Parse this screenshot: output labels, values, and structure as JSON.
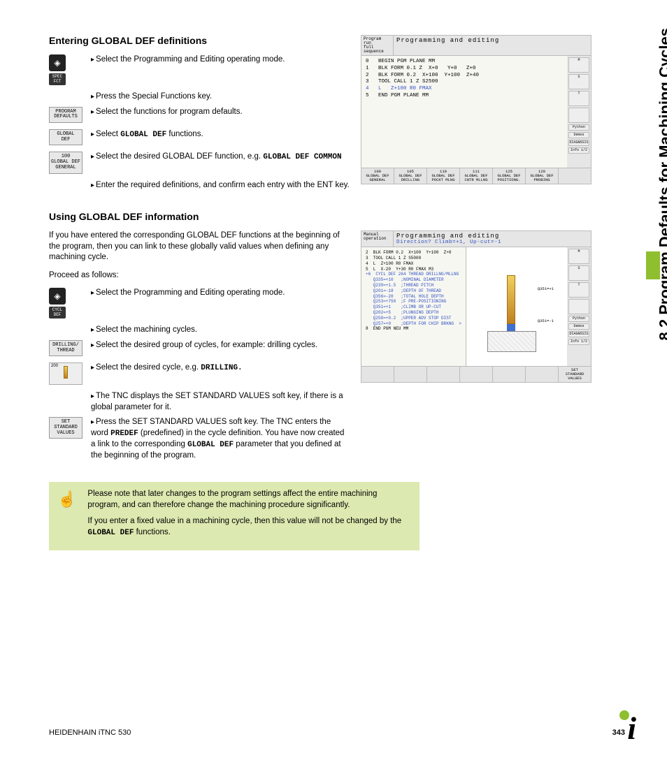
{
  "sideTab": "8.2 Program Defaults for Machining Cycles",
  "section1": {
    "heading": "Entering GLOBAL DEF definitions",
    "steps": [
      "Select the Programming and Editing operating mode.",
      "Press the Special Functions key.",
      "Select the functions for program defaults.",
      "Select ",
      "Select the desired GLOBAL DEF function, e.g. ",
      "Enter the required definitions, and confirm each entry with the ENT key."
    ],
    "step4mono": "GLOBAL DEF",
    "step4after": " functions.",
    "step5mono": "GLOBAL DEF COMMON",
    "softkeys": {
      "specfct": "SPEC\nFCT",
      "progdef": "PROGRAM\nDEFAULTS",
      "globaldef": "GLOBAL\nDEF",
      "gdgen": "100\nGLOBAL DEF\nGENERAL"
    }
  },
  "section2": {
    "heading": "Using GLOBAL DEF information",
    "intro": "If you have entered the corresponding GLOBAL DEF functions at the beginning of the program, then you can link to these globally valid values when defining any machining cycle.",
    "proceed": "Proceed as follows:",
    "steps": {
      "s1": "Select the Programming and Editing operating mode.",
      "s2": "Select the machining cycles.",
      "s3": "Select the desired group of cycles, for example: drilling cycles.",
      "s4pre": "Select the desired cycle, e.g. ",
      "s4mono": "DRILLING.",
      "s5": "The TNC displays the SET STANDARD VALUES soft key, if there is a global parameter for it.",
      "s6pre": "Press the SET STANDARD VALUES soft key. The TNC enters the word ",
      "s6mono1": "PREDEF",
      "s6mid": " (predefined) in the cycle definition. You have now created a link to the corresponding ",
      "s6mono2": "GLOBAL DEF",
      "s6post": " parameter that you defined at the beginning of the program."
    },
    "softkeys": {
      "cycldef": "CYCL\nDEF",
      "drilling": "DRILLING/\nTHREAD",
      "k200": "200",
      "setstd": "SET\nSTANDARD\nVALUES"
    }
  },
  "note": {
    "p1": "Please note that later changes to the program settings affect the entire machining program, and can therefore change the machining procedure significantly.",
    "p2pre": "If you enter a fixed value in a machining cycle, then this value will not be changed by the ",
    "p2mono": "GLOBAL DEF",
    "p2post": " functions."
  },
  "screenshot1": {
    "modeLeft": "Program run\nfull sequence",
    "title": "Programming and editing",
    "lines": [
      "0   BEGIN PGM PLANE MM",
      "1   BLK FORM 0.1 Z  X+0   Y+0   Z+0",
      "2   BLK FORM 0.2  X+100  Y+100  Z+40",
      "3   TOOL CALL 1 Z S2500",
      "4   L   Z+100 R0 FMAX",
      "5   END PGM PLANE MM"
    ],
    "hlLine": 4,
    "rside": [
      "M",
      "S",
      "T",
      "",
      "Python",
      "Demos",
      "DIAGNOSIS",
      "Info 1/2"
    ],
    "fkeys": [
      "100\nGLOBAL DEF\nGENERAL",
      "105\nGLOBAL DEF\nDRILLING",
      "110\nGLOBAL DEF\nPOCKT MLNG",
      "111\nGLOBAL DEF\nCNTR MLLNG",
      "125\nGLOBAL DEF\nPOSITIONG.",
      "120\nGLOBAL DEF\nPROBING",
      ""
    ]
  },
  "screenshot2": {
    "modeLeft": "Manual\noperation",
    "title": "Programming and editing",
    "prompt": "Direction? Climb=+1, Up-cut=-1",
    "lines": [
      "2  BLK FORM 0.2  X+100  Y+100  Z+0",
      "3  TOOL CALL 1 Z S5000",
      "4  L  Z+100 R0 FMAX",
      "5  L  X-20  Y+30 R0 FMAX M3",
      "+6  CYCL DEF 264 THREAD DRILLNG/MLLNG",
      "   Q335=+10   ;NOMINAL DIAMETER",
      "   Q239=+1.5  ;THREAD PITCH",
      "   Q201=-18   ;DEPTH OF THREAD",
      "   Q356=-20   ;TOTAL HOLE DEPTH",
      "   Q253=+750  ;F PRE-POSITIONING",
      "   Q351=+1    ;CLIMB OR UP-CUT",
      "   Q202=+5    ;PLUNGING DEPTH",
      "   Q258=+0.2  ;UPPER ADV STOP DIST",
      "   Q257=+0    ;DEPTH FOR CHIP BRKNG  >",
      "8  END PGM NEU MM"
    ],
    "annots": {
      "a1": "Q351=+1",
      "a2": "Q351=-1"
    },
    "rside": [
      "M",
      "S",
      "T",
      "",
      "Python",
      "Demos",
      "DIAGNOSIS",
      "Info 1/2"
    ],
    "fkeys": [
      "",
      "",
      "",
      "",
      "",
      "",
      "SET\nSTANDARD\nVALUES"
    ]
  },
  "footer": {
    "product": "HEIDENHAIN iTNC 530",
    "page": "343"
  }
}
